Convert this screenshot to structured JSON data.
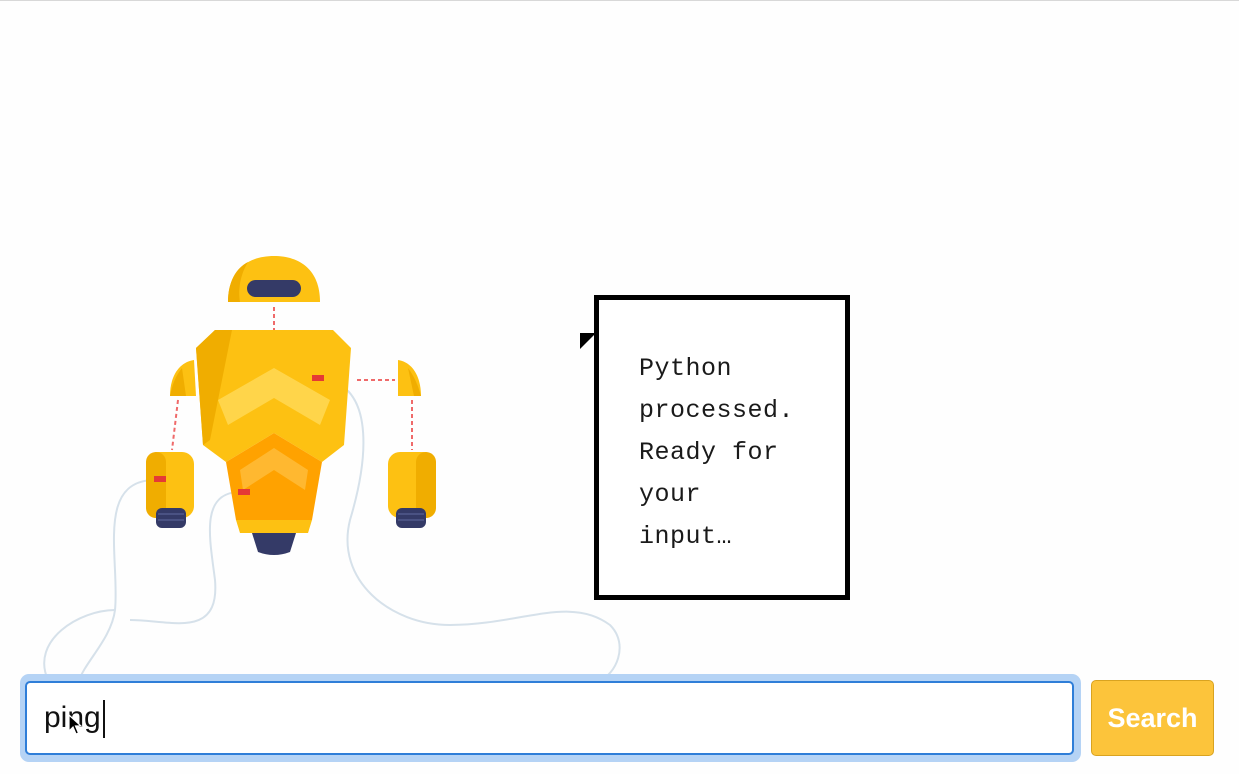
{
  "speech_bubble": {
    "lines": [
      "Python",
      "processed.",
      "Ready for",
      "your",
      "input…"
    ]
  },
  "search": {
    "value": "ping",
    "button_label": "Search"
  },
  "colors": {
    "robot_yellow": "#fdc112",
    "robot_orange": "#ffa200",
    "robot_navy": "#343a67",
    "input_focus": "#2f7ed8",
    "button_bg": "#fcc43b"
  }
}
